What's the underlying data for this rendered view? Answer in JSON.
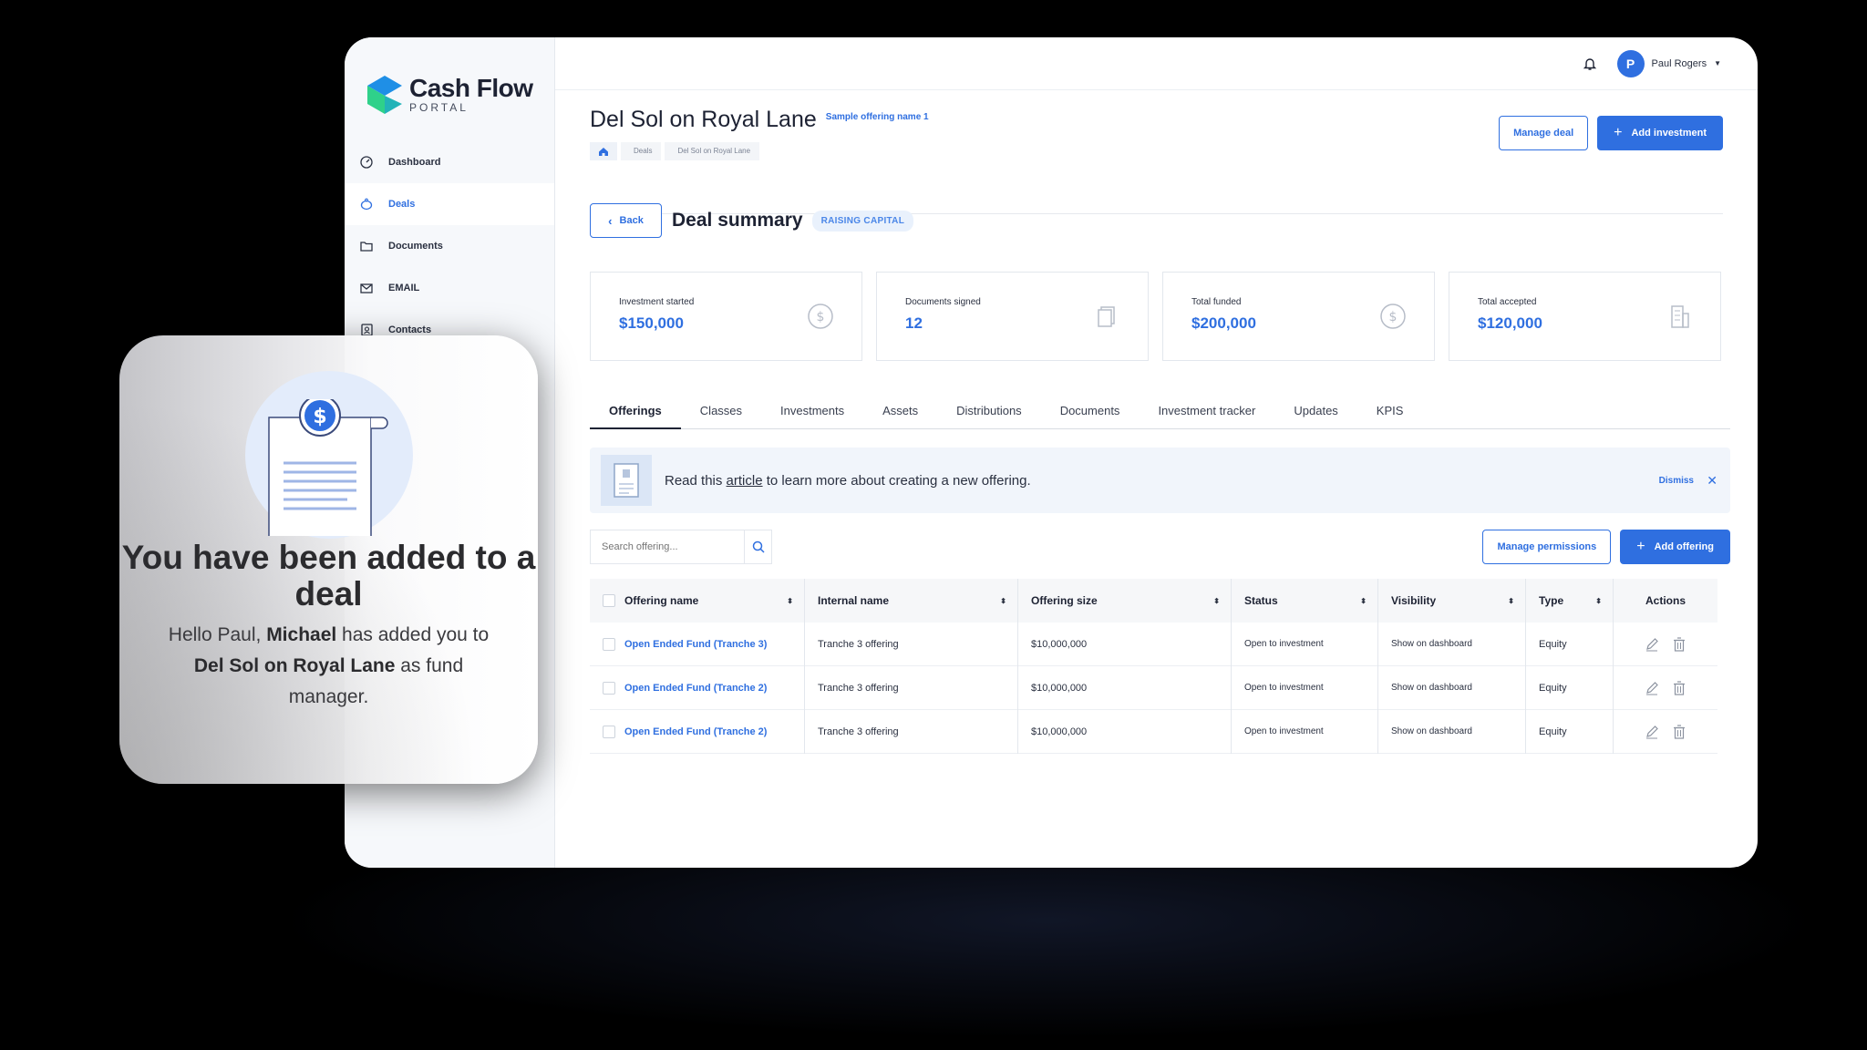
{
  "brand": {
    "name": "Cash Flow",
    "sub": "PORTAL"
  },
  "sidebar": {
    "items": [
      {
        "label": "Dashboard",
        "icon": "gauge-icon"
      },
      {
        "label": "Deals",
        "icon": "piggy-bank-icon",
        "active": true
      },
      {
        "label": "Documents",
        "icon": "folder-icon"
      },
      {
        "label": "EMAIL",
        "icon": "mail-icon"
      },
      {
        "label": "Contacts",
        "icon": "contacts-icon"
      }
    ]
  },
  "topbar": {
    "user_initial": "P",
    "user_name": "Paul Rogers"
  },
  "header": {
    "title": "Del Sol on Royal Lane",
    "tag": "Sample offering name 1",
    "breadcrumb": [
      "Deals",
      "Del Sol on Royal Lane"
    ],
    "manage_deal": "Manage deal",
    "add_investment": "Add investment"
  },
  "summary": {
    "back": "Back",
    "title": "Deal summary",
    "status": "RAISING CAPITAL"
  },
  "stats": [
    {
      "label": "Investment started",
      "value": "$150,000",
      "icon": "dollar-circle-icon"
    },
    {
      "label": "Documents signed",
      "value": "12",
      "icon": "document-copy-icon"
    },
    {
      "label": "Total funded",
      "value": "$200,000",
      "icon": "dollar-circle-icon"
    },
    {
      "label": "Total accepted",
      "value": "$120,000",
      "icon": "building-icon"
    }
  ],
  "tabs": [
    "Offerings",
    "Classes",
    "Investments",
    "Assets",
    "Distributions",
    "Documents",
    "Investment tracker",
    "Updates",
    "KPIS"
  ],
  "banner": {
    "text_before": "Read this ",
    "link": "article",
    "text_after": " to learn more about creating a new offering.",
    "dismiss": "Dismiss"
  },
  "search": {
    "placeholder": "Search offering..."
  },
  "actions": {
    "manage_permissions": "Manage permissions",
    "add_offering": "Add offering"
  },
  "table": {
    "headers": [
      "Offering name",
      "Internal name",
      "Offering size",
      "Status",
      "Visibility",
      "Type",
      "Actions"
    ],
    "rows": [
      {
        "name": "Open Ended Fund (Tranche 3)",
        "internal": "Tranche 3 offering",
        "size": "$10,000,000",
        "status": "Open to investment",
        "visibility": "Show on dashboard",
        "type": "Equity"
      },
      {
        "name": "Open Ended Fund (Tranche 2)",
        "internal": "Tranche 3 offering",
        "size": "$10,000,000",
        "status": "Open to investment",
        "visibility": "Show on dashboard",
        "type": "Equity"
      },
      {
        "name": "Open Ended Fund (Tranche 2)",
        "internal": "Tranche 3 offering",
        "size": "$10,000,000",
        "status": "Open to investment",
        "visibility": "Show on dashboard",
        "type": "Equity"
      }
    ]
  },
  "notice": {
    "title": "You have been added to a deal",
    "greeting": "Hello Paul, ",
    "actor": "Michael",
    "mid": " has added you to ",
    "deal": "Del Sol on Royal Lane",
    "end": " as fund manager."
  },
  "colors": {
    "accent": "#2f6fe0",
    "text": "#1d2233",
    "logo_blue": "#1f8fe6",
    "logo_green": "#2fd18a"
  }
}
